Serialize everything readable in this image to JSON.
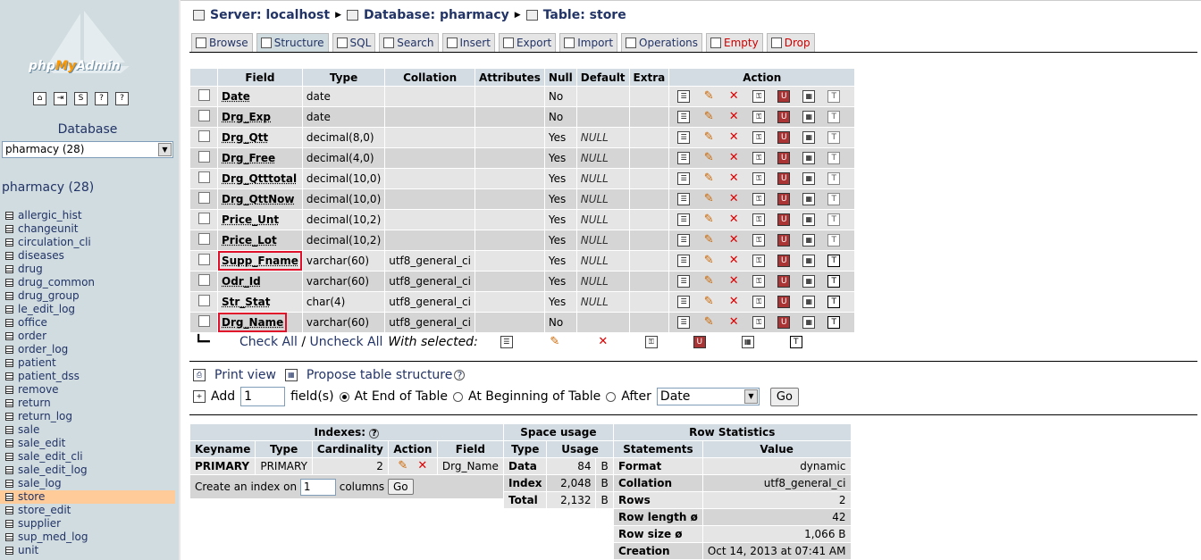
{
  "nav": {
    "logo": "phpMyAdmin",
    "database_label": "Database",
    "db_select": "pharmacy (28)",
    "db_title": "pharmacy (28)",
    "tables": [
      "allergic_hist",
      "changeunit",
      "circulation_cli",
      "diseases",
      "drug",
      "drug_common",
      "drug_group",
      "le_edit_log",
      "office",
      "order",
      "order_log",
      "patient",
      "patient_dss",
      "remove",
      "return",
      "return_log",
      "sale",
      "sale_edit",
      "sale_edit_cli",
      "sale_edit_log",
      "sale_log",
      "store",
      "store_edit",
      "supplier",
      "sup_med_log",
      "unit"
    ],
    "active_table": "store"
  },
  "breadcrumb": {
    "server": "Server: localhost",
    "database": "Database: pharmacy",
    "table": "Table: store"
  },
  "tabs": [
    "Browse",
    "Structure",
    "SQL",
    "Search",
    "Insert",
    "Export",
    "Import",
    "Operations",
    "Empty",
    "Drop"
  ],
  "structure": {
    "headers": [
      "Field",
      "Type",
      "Collation",
      "Attributes",
      "Null",
      "Default",
      "Extra",
      "Action"
    ],
    "rows": [
      {
        "field": "Date",
        "type": "date",
        "collation": "",
        "null": "No",
        "default": "",
        "highlight": false
      },
      {
        "field": "Drg_Exp",
        "type": "date",
        "collation": "",
        "null": "No",
        "default": "",
        "highlight": false
      },
      {
        "field": "Drg_Qtt",
        "type": "decimal(8,0)",
        "collation": "",
        "null": "Yes",
        "default": "NULL",
        "highlight": false
      },
      {
        "field": "Drg_Free",
        "type": "decimal(4,0)",
        "collation": "",
        "null": "Yes",
        "default": "NULL",
        "highlight": false
      },
      {
        "field": "Drg_Qtttotal",
        "type": "decimal(10,0)",
        "collation": "",
        "null": "Yes",
        "default": "NULL",
        "highlight": false
      },
      {
        "field": "Drg_QttNow",
        "type": "decimal(10,0)",
        "collation": "",
        "null": "Yes",
        "default": "NULL",
        "highlight": false
      },
      {
        "field": "Price_Unt",
        "type": "decimal(10,2)",
        "collation": "",
        "null": "Yes",
        "default": "NULL",
        "highlight": false
      },
      {
        "field": "Price_Lot",
        "type": "decimal(10,2)",
        "collation": "",
        "null": "Yes",
        "default": "NULL",
        "highlight": false
      },
      {
        "field": "Supp_Fname",
        "type": "varchar(60)",
        "collation": "utf8_general_ci",
        "null": "Yes",
        "default": "NULL",
        "highlight": true
      },
      {
        "field": "Odr_Id",
        "type": "varchar(60)",
        "collation": "utf8_general_ci",
        "null": "Yes",
        "default": "NULL",
        "highlight": false
      },
      {
        "field": "Str_Stat",
        "type": "char(4)",
        "collation": "utf8_general_ci",
        "null": "Yes",
        "default": "NULL",
        "highlight": false
      },
      {
        "field": "Drg_Name",
        "type": "varchar(60)",
        "collation": "utf8_general_ci",
        "null": "No",
        "default": "",
        "highlight": true
      }
    ],
    "check_all": "Check All",
    "slash": " / ",
    "uncheck_all": "Uncheck All",
    "with_selected": "With selected:"
  },
  "links": {
    "print_view": "Print view",
    "propose": "Propose table structure"
  },
  "add": {
    "add_label": "Add",
    "count": "1",
    "fields_label": "field(s)",
    "opt_end": "At End of Table",
    "opt_begin": "At Beginning of Table",
    "opt_after": "After",
    "after_field": "Date",
    "go": "Go"
  },
  "indexes": {
    "title": "Indexes:",
    "headers": [
      "Keyname",
      "Type",
      "Cardinality",
      "Action",
      "Field"
    ],
    "row": {
      "keyname": "PRIMARY",
      "type": "PRIMARY",
      "cardinality": "2",
      "field": "Drg_Name"
    },
    "create_label": "Create an index on",
    "create_count": "1",
    "columns_label": "columns",
    "go": "Go"
  },
  "space": {
    "title": "Space usage",
    "headers": [
      "Type",
      "Usage"
    ],
    "rows": [
      {
        "type": "Data",
        "usage": "84",
        "unit": "B"
      },
      {
        "type": "Index",
        "usage": "2,048",
        "unit": "B"
      },
      {
        "type": "Total",
        "usage": "2,132",
        "unit": "B"
      }
    ]
  },
  "rowstats": {
    "title": "Row Statistics",
    "headers": [
      "Statements",
      "Value"
    ],
    "rows": [
      {
        "k": "Format",
        "v": "dynamic"
      },
      {
        "k": "Collation",
        "v": "utf8_general_ci"
      },
      {
        "k": "Rows",
        "v": "2"
      },
      {
        "k": "Row length ø",
        "v": "42"
      },
      {
        "k": "Row size ø",
        "v": "1,066 B"
      },
      {
        "k": "Creation",
        "v": "Oct 14, 2013 at 07:41 AM"
      }
    ]
  },
  "colors": {
    "accent": "#223366",
    "highlight": "#e0102a",
    "active_row": "#ffcc99",
    "nav_bg": "#d0dce0"
  }
}
